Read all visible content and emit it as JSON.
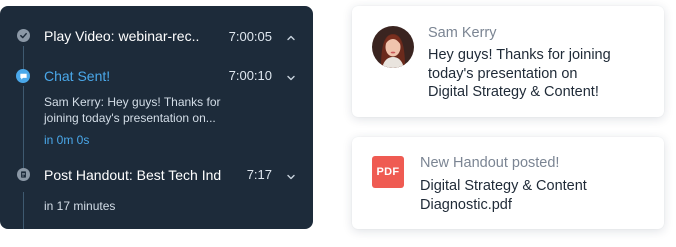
{
  "timeline": {
    "events": [
      {
        "title": "Play Video: webinar-rec..",
        "time": "7:00:05",
        "icon": "check-circle-icon",
        "chevron": "chevron-up-icon"
      },
      {
        "title": "Chat Sent!",
        "time": "7:00:10",
        "icon": "chat-bubble-icon",
        "chevron": "chevron-down-icon",
        "message_line1": "Sam Kerry: Hey guys! Thanks for",
        "message_line2": "joining today's presentation on...",
        "eta": "in 0m 0s"
      },
      {
        "title": "Post Handout: Best Tech Ind",
        "time": "7:17",
        "icon": "document-icon",
        "chevron": "chevron-down-icon",
        "eta": "in 17 minutes"
      }
    ]
  },
  "chat_card": {
    "name": "Sam Kerry",
    "line1": "Hey guys! Thanks for joining",
    "line2": "today's presentation on",
    "line3": "Digital Strategy & Content!",
    "avatar": "avatar"
  },
  "handout_card": {
    "heading": "New Handout posted!",
    "badge": "PDF",
    "file_line1": "Digital Strategy & Content",
    "file_line2": "Diagnostic.pdf"
  },
  "colors": {
    "panel_bg": "#1d2b3a",
    "accent_blue": "#4aa8ea",
    "pdf_red": "#ef5b52"
  }
}
